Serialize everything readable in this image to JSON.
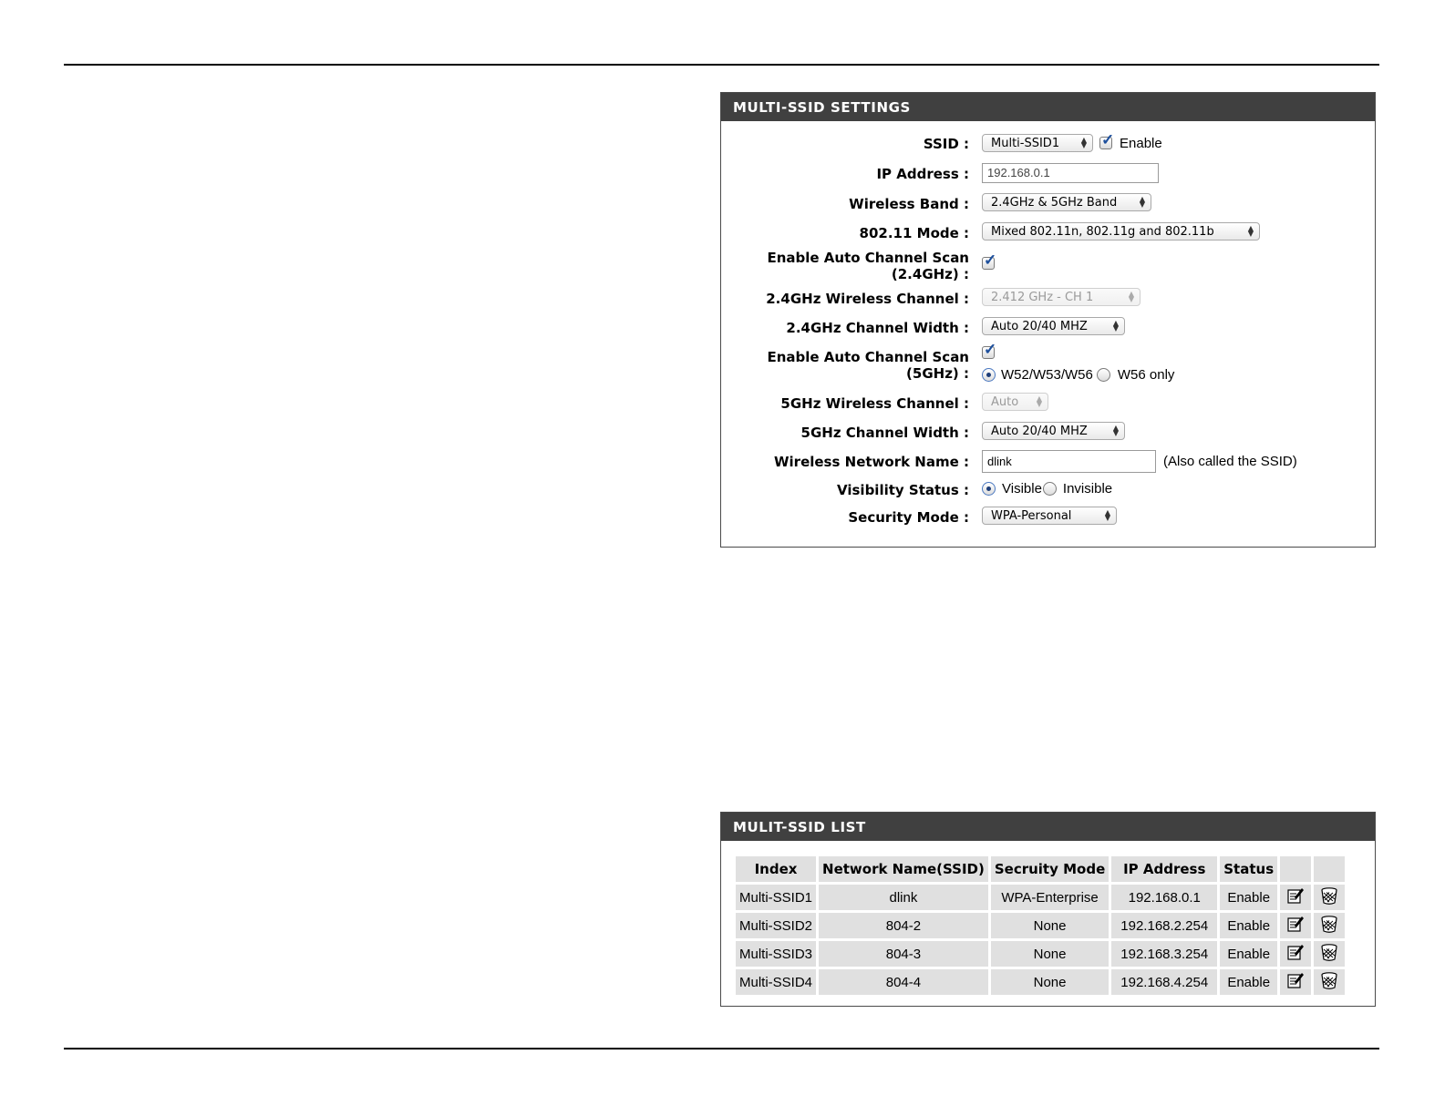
{
  "settings": {
    "title": "MULTI-SSID SETTINGS",
    "ssid": {
      "label": "SSID :",
      "value": "Multi-SSID1",
      "enable_label": "Enable",
      "enabled": true
    },
    "ip_address": {
      "label": "IP Address :",
      "value": "192.168.0.1"
    },
    "wireless_band": {
      "label": "Wireless Band :",
      "value": "2.4GHz & 5GHz Band"
    },
    "mode": {
      "label": "802.11 Mode :",
      "value": "Mixed 802.11n, 802.11g and 802.11b"
    },
    "auto_scan_24": {
      "label_line1": "Enable Auto Channel Scan",
      "label_line2": "(2.4GHz) :",
      "checked": true
    },
    "channel_24": {
      "label": "2.4GHz Wireless Channel :",
      "value": "2.412 GHz - CH 1",
      "disabled": true
    },
    "width_24": {
      "label": "2.4GHz Channel Width :",
      "value": "Auto 20/40 MHZ"
    },
    "auto_scan_5": {
      "label_line1": "Enable Auto Channel Scan",
      "label_line2": "(5GHz) :",
      "checked": true,
      "option_a": "W52/W53/W56",
      "option_b": "W56 only",
      "selected": "option_a"
    },
    "channel_5": {
      "label": "5GHz Wireless Channel :",
      "value": "Auto",
      "disabled": true
    },
    "width_5": {
      "label": "5GHz Channel Width :",
      "value": "Auto 20/40 MHZ"
    },
    "network_name": {
      "label": "Wireless Network Name :",
      "value": "dlink",
      "note": "(Also called the SSID)"
    },
    "visibility": {
      "label": "Visibility Status :",
      "option_a": "Visible",
      "option_b": "Invisible",
      "selected": "option_a"
    },
    "security": {
      "label": "Security Mode :",
      "value": "WPA-Personal"
    }
  },
  "list": {
    "title": "MULIT-SSID LIST",
    "headers": [
      "Index",
      "Network Name(SSID)",
      "Secruity Mode",
      "IP Address",
      "Status"
    ],
    "rows": [
      [
        "Multi-SSID1",
        "dlink",
        "WPA-Enterprise",
        "192.168.0.1",
        "Enable"
      ],
      [
        "Multi-SSID2",
        "804-2",
        "None",
        "192.168.2.254",
        "Enable"
      ],
      [
        "Multi-SSID3",
        "804-3",
        "None",
        "192.168.3.254",
        "Enable"
      ],
      [
        "Multi-SSID4",
        "804-4",
        "None",
        "192.168.4.254",
        "Enable"
      ]
    ],
    "row_icons": [
      "edit-icon",
      "delete-icon"
    ]
  }
}
